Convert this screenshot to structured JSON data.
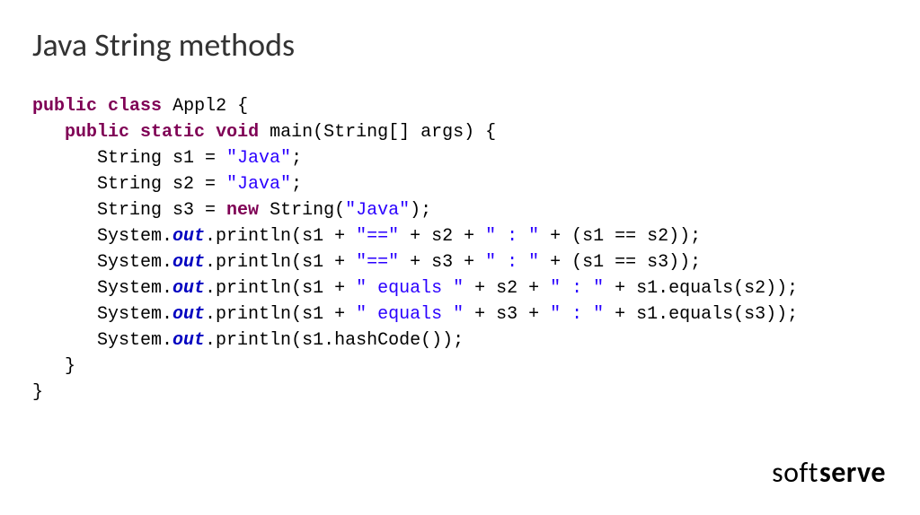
{
  "title": "Java String methods",
  "code": {
    "kw_public": "public",
    "kw_class": "class",
    "kw_static": "static",
    "kw_void": "void",
    "kw_new": "new",
    "class_name": "Appl2",
    "main_sig": "main(String[] args) {",
    "line3": "      String s1 = ",
    "str_java": "\"Java\"",
    "semi": ";",
    "line4": "      String s2 = ",
    "line5a": "      String s3 = ",
    "line5b": " String(",
    "line5c": ");",
    "sys": "      System.",
    "out": "out",
    "println_open": ".println(s1 + ",
    "str_eqeq": "\"==\"",
    "plus_s2": " + s2 + ",
    "plus_s3": " + s3 + ",
    "str_colon": "\" : \"",
    "tail_s1s2": " + (s1 == s2));",
    "tail_s1s3": " + (s1 == s3));",
    "str_equals": "\" equals \"",
    "tail_eq_s2": " + s1.equals(s2));",
    "tail_eq_s3": " + s1.equals(s3));",
    "println_hash": ".println(s1.hashCode());",
    "close1": "   }",
    "close2": "}",
    "open_brace": " {",
    "sp": " "
  },
  "brand": {
    "part1": "soft",
    "part2": "serve"
  }
}
